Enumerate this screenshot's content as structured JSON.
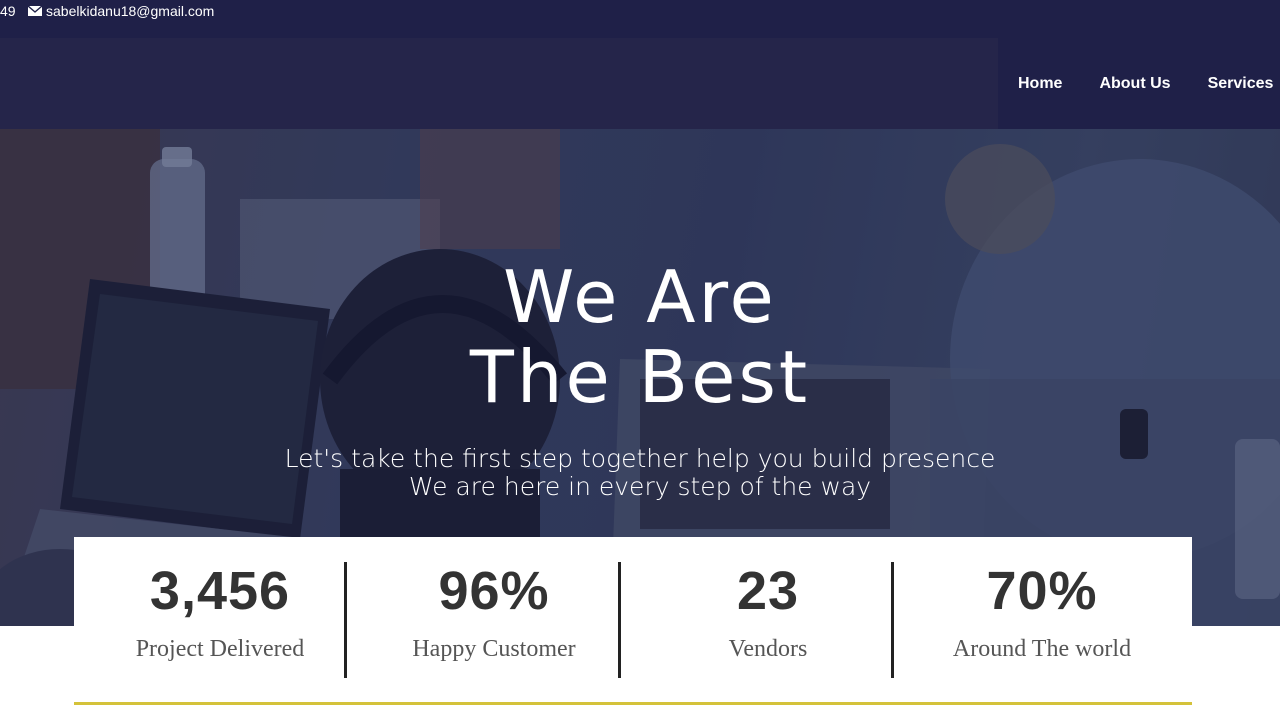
{
  "topbar": {
    "phone_tail": "49",
    "email": "sabelkidanu18@gmail.com"
  },
  "nav": {
    "items": [
      {
        "label": "Home"
      },
      {
        "label": "About Us"
      },
      {
        "label": "Services"
      }
    ]
  },
  "hero": {
    "title_line1": "We Are",
    "title_line2": "The Best",
    "subtitle_line1": "Let's take the first step together help you build presence",
    "subtitle_line2": "We are here in every step of the way"
  },
  "stats": [
    {
      "value": "3,456",
      "label": "Project Delivered"
    },
    {
      "value": "96%",
      "label": "Happy Customer"
    },
    {
      "value": "23",
      "label": "Vendors"
    },
    {
      "value": "70%",
      "label": "Around The world"
    }
  ],
  "colors": {
    "header_bg": "#1f2048",
    "accent_rule": "#d4c23a",
    "stat_text": "#333333"
  },
  "icons": {
    "email": "envelope-icon"
  }
}
